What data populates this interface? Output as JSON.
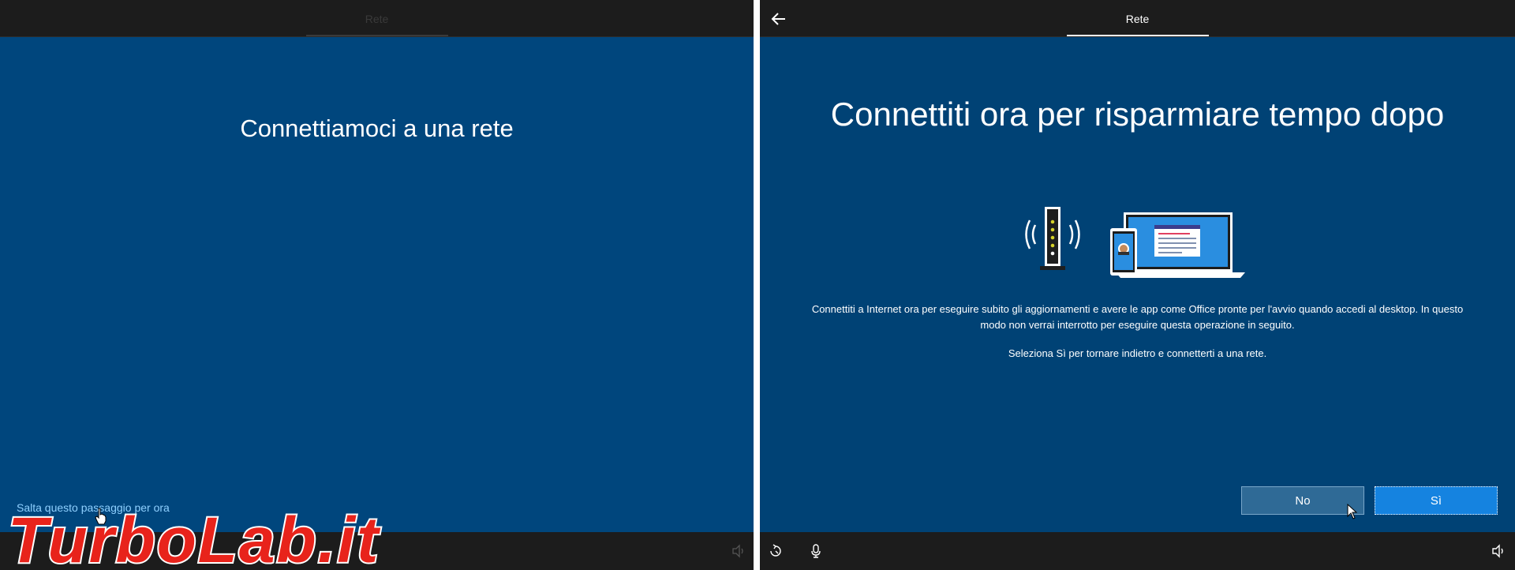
{
  "left_screen": {
    "tab_title": "Rete",
    "heading": "Connettiamoci a una rete",
    "skip_link": "Salta questo passaggio per ora",
    "bottom_icons": [
      "volume-icon"
    ]
  },
  "right_screen": {
    "tab_title": "Rete",
    "heading": "Connettiti ora per risparmiare tempo dopo",
    "description_1": "Connettiti a Internet ora per eseguire subito gli aggiornamenti e avere le app come Office pronte per l'avvio quando accedi al desktop. In questo modo non verrai interrotto per eseguire questa operazione in seguito.",
    "description_2": "Seleziona Sì per tornare indietro e connetterti a una rete.",
    "buttons": {
      "no": "No",
      "yes": "Sì"
    },
    "bottom_icons": [
      "accessibility-icon",
      "microphone-icon",
      "volume-icon"
    ]
  },
  "watermark": {
    "text": "TurboLab.it"
  },
  "colors": {
    "oobe_blue": "#004275",
    "bar_dark": "#1c1c1c",
    "primary_button": "#1583e0",
    "secondary_button": "#2f6a96",
    "link": "#8fd0ff",
    "watermark_red": "#e8231b"
  }
}
